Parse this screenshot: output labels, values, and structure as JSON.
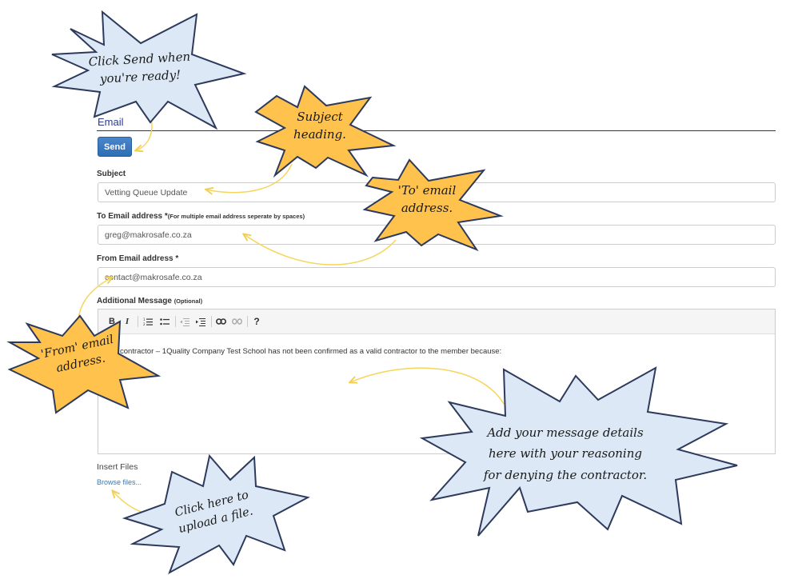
{
  "form": {
    "heading": "Email",
    "send_label": "Send",
    "subject": {
      "label": "Subject",
      "value": "Vetting Queue Update"
    },
    "to_email": {
      "label": "To Email address *",
      "hint": "(For multiple email address seperate by spaces)",
      "value": "greg@makrosafe.co.za"
    },
    "from_email": {
      "label": "From Email address *",
      "value": "contact@makrosafe.co.za"
    },
    "message": {
      "label": "Additional Message",
      "hint": "(Optional)",
      "body": "The contractor – 1Quality Company Test School has not been confirmed as a valid contractor to the member because:",
      "toolbar": [
        "B",
        "I",
        "ordered-list",
        "bullet-list",
        "outdent",
        "indent",
        "link",
        "unlink",
        "?"
      ]
    },
    "insert_files_label": "Insert Files",
    "browse_label": "Browse files..."
  },
  "callouts": {
    "send": {
      "line1": "Click Send when",
      "line2": "you're ready!"
    },
    "subject": {
      "line1": "Subject",
      "line2": "heading."
    },
    "to": {
      "line1": "'To' email",
      "line2": "address."
    },
    "from": {
      "line1": "'From' email",
      "line2": "address."
    },
    "message": {
      "line1": "Add your message details",
      "line2": "here with your reasoning",
      "line3": "for denying the contractor."
    },
    "upload": {
      "line1": "Click here to",
      "line2": "upload a file."
    }
  },
  "colors": {
    "blue_burst": "#dce8f5",
    "orange_burst": "#ffc24d",
    "burst_stroke": "#2d3a5c",
    "arrow": "#f5d55a",
    "button": "#337ab7",
    "heading_rule": "#2b2f6e"
  }
}
